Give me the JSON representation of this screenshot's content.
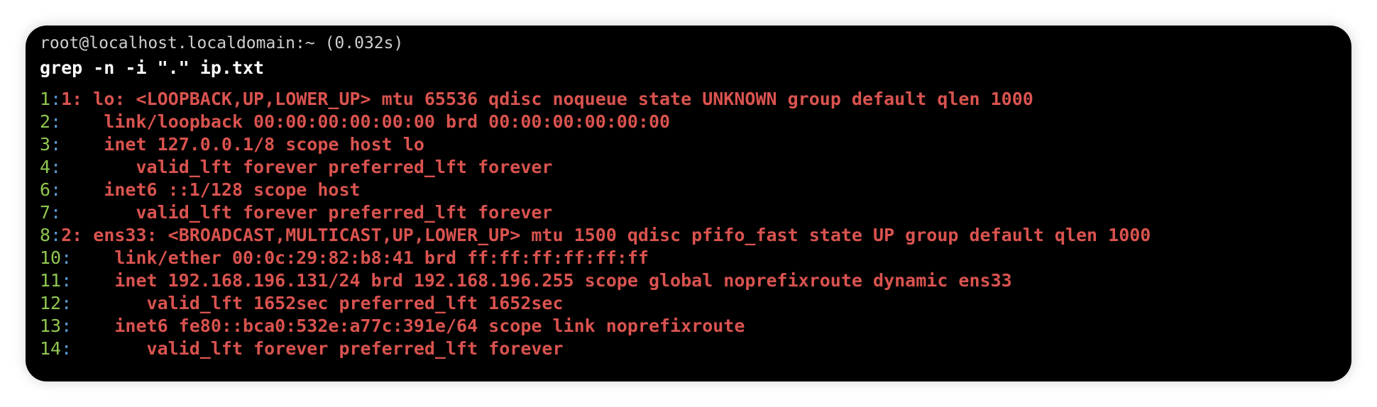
{
  "colors": {
    "background": "#000000",
    "line_number": "#8fc751",
    "separator": "#5a9bd4",
    "match": "#d9534f",
    "prompt": "#cfcfcf",
    "command": "#ffffff"
  },
  "prompt": "root@localhost.localdomain:~ (0.032s)",
  "command": "grep -n -i \".\" ip.txt",
  "output": [
    {
      "num": "1",
      "text": "1: lo: <LOOPBACK,UP,LOWER_UP> mtu 65536 qdisc noqueue state UNKNOWN group default qlen 1000"
    },
    {
      "num": "2",
      "text": "    link/loopback 00:00:00:00:00:00 brd 00:00:00:00:00:00"
    },
    {
      "num": "3",
      "text": "    inet 127.0.0.1/8 scope host lo"
    },
    {
      "num": "4",
      "text": "       valid_lft forever preferred_lft forever"
    },
    {
      "num": "6",
      "text": "    inet6 ::1/128 scope host"
    },
    {
      "num": "7",
      "text": "       valid_lft forever preferred_lft forever"
    },
    {
      "num": "8",
      "text": "2: ens33: <BROADCAST,MULTICAST,UP,LOWER_UP> mtu 1500 qdisc pfifo_fast state UP group default qlen 1000"
    },
    {
      "num": "10",
      "text": "    link/ether 00:0c:29:82:b8:41 brd ff:ff:ff:ff:ff:ff"
    },
    {
      "num": "11",
      "text": "    inet 192.168.196.131/24 brd 192.168.196.255 scope global noprefixroute dynamic ens33"
    },
    {
      "num": "12",
      "text": "       valid_lft 1652sec preferred_lft 1652sec"
    },
    {
      "num": "13",
      "text": "    inet6 fe80::bca0:532e:a77c:391e/64 scope link noprefixroute"
    },
    {
      "num": "14",
      "text": "       valid_lft forever preferred_lft forever"
    }
  ]
}
